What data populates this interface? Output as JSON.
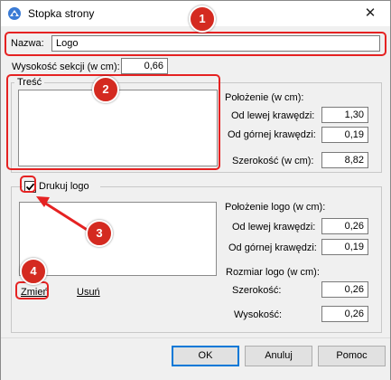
{
  "window": {
    "title": "Stopka strony",
    "close_symbol": "✕"
  },
  "name_field": {
    "label": "Nazwa:",
    "value": "Logo"
  },
  "section_height": {
    "label": "Wysokość sekcji (w cm):",
    "value": "0,66"
  },
  "content_group": {
    "legend": "Treść",
    "position_label": "Położenie (w cm):",
    "left_label": "Od lewej krawędzi:",
    "left_value": "1,30",
    "top_label": "Od górnej krawędzi:",
    "top_value": "0,19",
    "width_label": "Szerokość (w cm):",
    "width_value": "8,82"
  },
  "logo_group": {
    "checkbox_label": "Drukuj logo",
    "checked": true,
    "position_label": "Położenie logo (w cm):",
    "left_label": "Od lewej krawędzi:",
    "left_value": "0,26",
    "top_label": "Od górnej krawędzi:",
    "top_value": "0,19",
    "size_label": "Rozmiar logo (w cm):",
    "width_label": "Szerokość:",
    "width_value": "0,26",
    "height_label": "Wysokość:",
    "height_value": "0,26",
    "change_link": "Zmień",
    "remove_link": "Usuń"
  },
  "buttons": {
    "ok": "OK",
    "cancel": "Anuluj",
    "help": "Pomoc"
  },
  "annotations": {
    "badge1": "1",
    "badge2": "2",
    "badge3": "3",
    "badge4": "4",
    "color": "#e52222"
  }
}
